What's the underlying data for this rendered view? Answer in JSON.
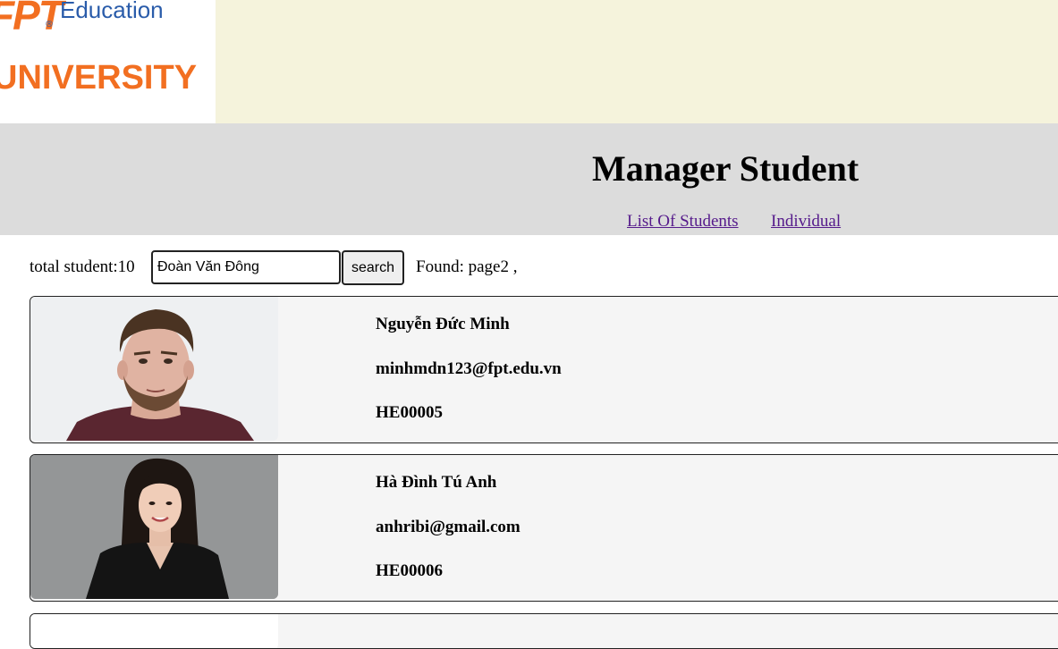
{
  "logo": {
    "brand": "FPT",
    "registered": "®",
    "division": "Education",
    "university": "UNIVERSITY"
  },
  "header": {
    "title": "Manager Student",
    "nav": [
      {
        "label": "List Of Students"
      },
      {
        "label": "Individual"
      }
    ]
  },
  "search": {
    "total_label": "total student:10",
    "query": "Đoàn Văn Đông",
    "button_label": "search",
    "found_label": "Found: page2 ,"
  },
  "students": [
    {
      "name": "Nguyễn Đức Minh",
      "email": "minhmdn123@fpt.edu.vn",
      "id": "HE00005",
      "photo": "male-student-photo"
    },
    {
      "name": "Hà Đình Tú Anh",
      "email": "anhribi@gmail.com",
      "id": "HE00006",
      "photo": "female-student-photo"
    }
  ],
  "colors": {
    "banner": "#f5f3dc",
    "header_band": "#dcdcdc",
    "card_bg": "#f5f5f5",
    "link_visited": "#551a8b",
    "brand_orange": "#f26f21",
    "brand_blue": "#2a5caa"
  }
}
